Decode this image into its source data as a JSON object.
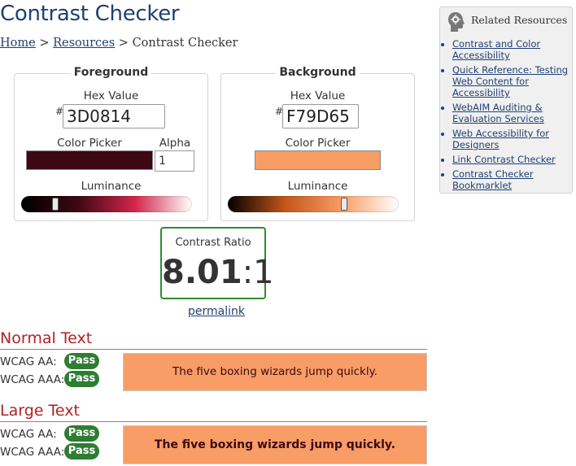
{
  "page": {
    "title": "Contrast Checker",
    "breadcrumb": {
      "home": "Home",
      "sep1": " > ",
      "resources": "Resources",
      "sep2": " > ",
      "current": "Contrast Checker"
    }
  },
  "foreground": {
    "heading": "Foreground",
    "hex_label": "Hex Value",
    "hash": "#",
    "hex_value": "3D0814",
    "color": "#3D0814",
    "picker_label": "Color Picker",
    "alpha_label": "Alpha",
    "alpha_value": "1",
    "luminance_label": "Luminance",
    "luminance_level": 0.2,
    "track_gradient": [
      "#000000",
      "#3D0814",
      "#d4254a",
      "#ffffff"
    ]
  },
  "background": {
    "heading": "Background",
    "hex_label": "Hex Value",
    "hash": "#",
    "hex_value": "F79D65",
    "color": "#F79D65",
    "picker_label": "Color Picker",
    "luminance_label": "Luminance",
    "luminance_level": 0.68,
    "track_gradient": [
      "#000000",
      "#c2561a",
      "#F79D65",
      "#ffffff"
    ]
  },
  "contrast": {
    "label": "Contrast Ratio",
    "ratio_main": "8.01",
    "ratio_suffix": ":1",
    "permalink": "permalink",
    "border_color": "#2e8b2e"
  },
  "normal_text": {
    "title": "Normal Text",
    "aa_label": "WCAG AA:",
    "aa_result": "Pass",
    "aaa_label": "WCAG AAA:",
    "aaa_result": "Pass",
    "sample": "The five boxing wizards jump quickly."
  },
  "large_text": {
    "title": "Large Text",
    "aa_label": "WCAG AA:",
    "aa_result": "Pass",
    "aaa_label": "WCAG AAA:",
    "aaa_result": "Pass",
    "sample": "The five boxing wizards jump quickly."
  },
  "sidebar": {
    "icon": "head-gear-icon",
    "heading": "Related Resources",
    "links": [
      "Contrast and Color Accessibility",
      "Quick Reference: Testing Web Content for Accessibility",
      "WebAIM Auditing & Evaluation Services",
      "Web Accessibility for Designers",
      "Link Contrast Checker",
      "Contrast Checker Bookmarklet"
    ]
  },
  "colors": {
    "title": "#1f3f74",
    "link": "#1f3f74",
    "section": "#b22222",
    "pass": "#2e7d32"
  }
}
